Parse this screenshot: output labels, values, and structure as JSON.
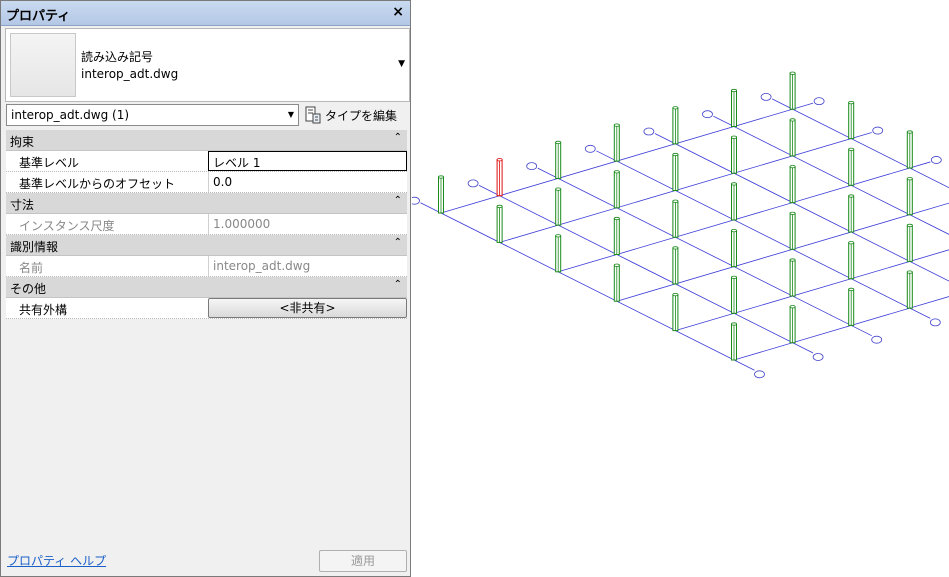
{
  "panel": {
    "title": "プロパティ",
    "close_glyph": "×",
    "type_selector": {
      "family": "読み込み記号",
      "type": "interop_adt.dwg",
      "arrow": "▼"
    },
    "instance_filter": {
      "value": "interop_adt.dwg (1)",
      "arrow": "▼"
    },
    "edit_type_label": "タイプを編集",
    "collapse_glyph": "⌃",
    "categories": [
      {
        "name": "拘束",
        "rows": [
          {
            "label": "基準レベル",
            "value": "レベル 1",
            "kind": "input"
          },
          {
            "label": "基準レベルからのオフセット",
            "value": "0.0",
            "kind": "text"
          }
        ]
      },
      {
        "name": "寸法",
        "rows": [
          {
            "label": "インスタンス尺度",
            "value": "1.000000",
            "kind": "readonly"
          }
        ]
      },
      {
        "name": "識別情報",
        "rows": [
          {
            "label": "名前",
            "value": "interop_adt.dwg",
            "kind": "readonly"
          }
        ]
      },
      {
        "name": "その他",
        "rows": [
          {
            "label": "共有外構",
            "value": "<非共有>",
            "kind": "button"
          }
        ]
      }
    ],
    "help_link": "プロパティ ヘルプ",
    "apply_label": "適用"
  },
  "viewport": {
    "grid_line_color": "#3c3cd8",
    "column_color": "#1a8a1a",
    "selected_column_color": "#e01010",
    "bubble_color": "#4444cc"
  }
}
